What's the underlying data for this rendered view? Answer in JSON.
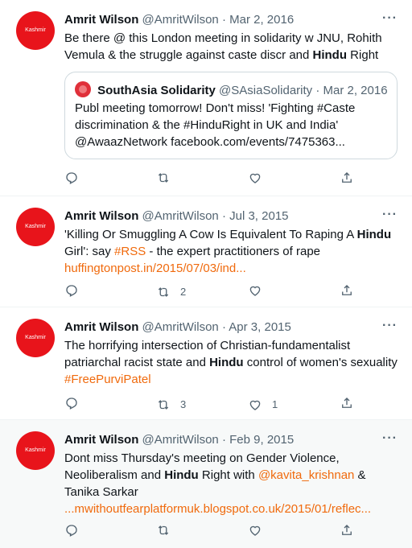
{
  "tweets": [
    {
      "avatar_text": "Kashmir",
      "name": "Amrit Wilson",
      "handle": "@AmritWilson",
      "date": "Mar 2, 2016",
      "text_a": "Be there @ this London meeting in solidarity w JNU, Rohith Vemula & the struggle against caste discr and ",
      "hindu": "Hindu",
      "text_b": " Right",
      "quote": {
        "name": "SouthAsia Solidarity",
        "handle": "@SAsiaSolidarity",
        "date": "Mar 2, 2016",
        "text": "Publ meeting tomorrow! Don't miss! 'Fighting #Caste discrimination & the #HinduRight in UK and India' @AwaazNetwork facebook.com/events/7475363..."
      },
      "retweets": "",
      "likes": ""
    },
    {
      "avatar_text": "Kashmir",
      "name": "Amrit Wilson",
      "handle": "@AmritWilson",
      "date": "Jul 3, 2015",
      "text_a": "'Killing Or Smuggling A Cow Is Equivalent To Raping A ",
      "hindu": "Hindu",
      "text_b": " Girl': say ",
      "hashtag": "#RSS",
      "text_c": " - the expert practitioners of rape",
      "link": "huffingtonpost.in/2015/07/03/ind...",
      "retweets": "2",
      "likes": ""
    },
    {
      "avatar_text": "Kashmir",
      "name": "Amrit Wilson",
      "handle": "@AmritWilson",
      "date": "Apr 3, 2015",
      "text_a": "The horrifying intersection of Christian-fundamentalist patriarchal racist state and ",
      "hindu": "Hindu",
      "text_b": " control of women's sexuality ",
      "hashtag": "#FreePurviPatel",
      "retweets": "3",
      "likes": "1"
    },
    {
      "avatar_text": "Kashmir",
      "name": "Amrit Wilson",
      "handle": "@AmritWilson",
      "date": "Feb 9, 2015",
      "text_a": "Dont miss Thursday's meeting on Gender Violence, Neoliberalism and ",
      "hindu": "Hindu",
      "text_b": " Right  with ",
      "mention": "@kavita_krishnan",
      "text_c": " & Tanika Sarkar",
      "link": "...mwithoutfearplatformuk.blogspot.co.uk/2015/01/reflec...",
      "retweets": "",
      "likes": ""
    }
  ],
  "separator": " · ",
  "more_label": "···",
  "colors": {
    "accent": "#f06a0d",
    "avatar": "#e8141b",
    "muted": "#536471"
  }
}
